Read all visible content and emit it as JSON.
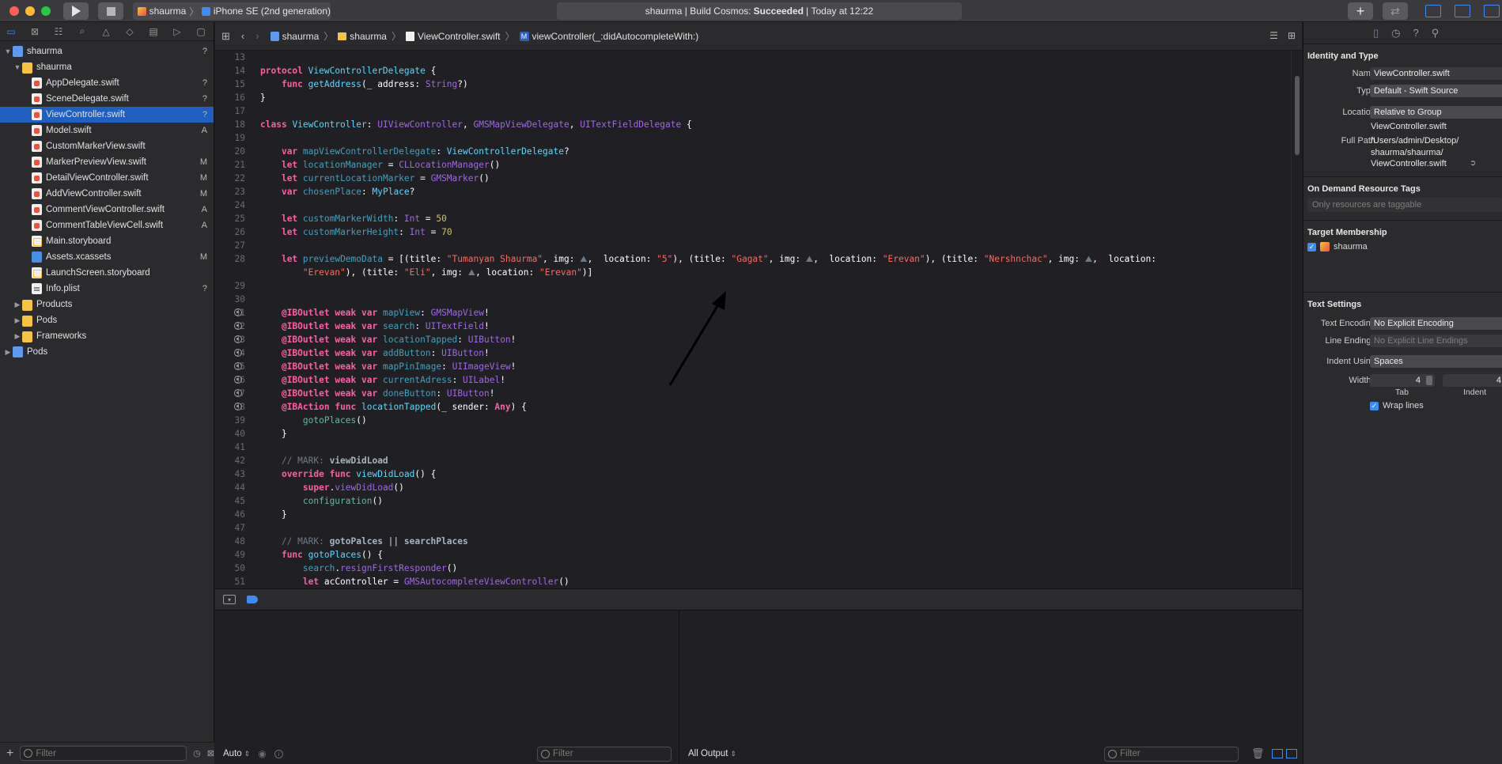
{
  "toolbar": {
    "scheme_target": "shaurma",
    "scheme_device": "iPhone SE (2nd generation)",
    "status_project": "shaurma",
    "status_build_label": "Build Cosmos:",
    "status_result": "Succeeded",
    "status_time": "Today at 12:22",
    "status_sep": "|"
  },
  "navigator": {
    "items": [
      {
        "label": "shaurma",
        "status": "?",
        "icon": "project-icon",
        "indent": 0,
        "disclosure": "open"
      },
      {
        "label": "shaurma",
        "status": "",
        "icon": "folder-icon",
        "indent": 1,
        "disclosure": "open"
      },
      {
        "label": "AppDelegate.swift",
        "status": "?",
        "icon": "swift-file-icon",
        "indent": 2
      },
      {
        "label": "SceneDelegate.swift",
        "status": "?",
        "icon": "swift-file-icon",
        "indent": 2
      },
      {
        "label": "ViewController.swift",
        "status": "?",
        "icon": "swift-file-icon",
        "indent": 2,
        "selected": true
      },
      {
        "label": "Model.swift",
        "status": "A",
        "icon": "swift-file-icon",
        "indent": 2
      },
      {
        "label": "CustomMarkerView.swift",
        "status": "",
        "icon": "swift-file-icon",
        "indent": 2
      },
      {
        "label": "MarkerPreviewView.swift",
        "status": "M",
        "icon": "swift-file-icon",
        "indent": 2
      },
      {
        "label": "DetailViewController.swift",
        "status": "M",
        "icon": "swift-file-icon",
        "indent": 2
      },
      {
        "label": "AddViewController.swift",
        "status": "M",
        "icon": "swift-file-icon",
        "indent": 2
      },
      {
        "label": "CommentViewController.swift",
        "status": "A",
        "icon": "swift-file-icon",
        "indent": 2
      },
      {
        "label": "CommentTableViewCell.swift",
        "status": "A",
        "icon": "swift-file-icon",
        "indent": 2
      },
      {
        "label": "Main.storyboard",
        "status": "",
        "icon": "storyboard-icon",
        "indent": 2
      },
      {
        "label": "Assets.xcassets",
        "status": "M",
        "icon": "assets-icon",
        "indent": 2
      },
      {
        "label": "LaunchScreen.storyboard",
        "status": "",
        "icon": "storyboard-icon",
        "indent": 2
      },
      {
        "label": "Info.plist",
        "status": "?",
        "icon": "plist-icon",
        "indent": 2
      },
      {
        "label": "Products",
        "status": "",
        "icon": "folder-icon",
        "indent": 1,
        "disclosure": "closed"
      },
      {
        "label": "Pods",
        "status": "",
        "icon": "folder-icon",
        "indent": 1,
        "disclosure": "closed"
      },
      {
        "label": "Frameworks",
        "status": "",
        "icon": "folder-icon",
        "indent": 1,
        "disclosure": "closed"
      },
      {
        "label": "Pods",
        "status": "",
        "icon": "project-icon",
        "indent": 0,
        "disclosure": "closed"
      }
    ],
    "filter_placeholder": "Filter"
  },
  "breadcrumb": {
    "project": "shaurma",
    "folder": "shaurma",
    "file": "ViewController.swift",
    "symbol_badge": "M",
    "symbol": "viewController(_:didAutocompleteWith:)"
  },
  "editor": {
    "lines": [
      {
        "n": "13",
        "html": ""
      },
      {
        "n": "14",
        "html": "<span class='kw'>protocol</span> <span class='ty'>ViewControllerDelegate</span> {"
      },
      {
        "n": "15",
        "html": "    <span class='kw'>func</span> <span class='ty'>getAddress</span>(_ address: <span class='tyb'>String</span>?)"
      },
      {
        "n": "16",
        "html": "}"
      },
      {
        "n": "17",
        "html": ""
      },
      {
        "n": "18",
        "html": "<span class='kw'>class</span> <span class='ty'>ViewController</span>: <span class='tyb'>UIViewController</span>, <span class='tyb'>GMSMapViewDelegate</span>, <span class='tyb'>UITextFieldDelegate</span> {"
      },
      {
        "n": "19",
        "html": ""
      },
      {
        "n": "20",
        "html": "    <span class='kw'>var</span> <span class='prop'>mapViewControllerDelegate</span>: <span class='ty'>ViewControllerDelegate</span>?"
      },
      {
        "n": "21",
        "html": "    <span class='kw'>let</span> <span class='prop'>locationManager</span> = <span class='tyb'>CLLocationManager</span>()"
      },
      {
        "n": "22",
        "html": "    <span class='kw'>let</span> <span class='prop'>currentLocationMarker</span> = <span class='tyb'>GMSMarker</span>()"
      },
      {
        "n": "23",
        "html": "    <span class='kw'>var</span> <span class='prop'>chosenPlace</span>: <span class='ty'>MyPlace</span>?"
      },
      {
        "n": "24",
        "html": ""
      },
      {
        "n": "25",
        "html": "    <span class='kw'>let</span> <span class='prop'>customMarkerWidth</span>: <span class='tyb'>Int</span> = <span class='num'>50</span>"
      },
      {
        "n": "26",
        "html": "    <span class='kw'>let</span> <span class='prop'>customMarkerHeight</span>: <span class='tyb'>Int</span> = <span class='num'>70</span>"
      },
      {
        "n": "27",
        "html": ""
      },
      {
        "n": "28",
        "html": "    <span class='kw'>let</span> <span class='prop'>previewDemoData</span> = [(title: <span class='str'>\"Tumanyan Shaurma\"</span>, img: <span class='cm'>⛰</span>,  location: <span class='str'>\"5\"</span>), (title: <span class='str'>\"Gagat\"</span>, img: <span class='cm'>⛰</span>,  location: <span class='str'>\"Erevan\"</span>), (title: <span class='str'>\"Nershnchac\"</span>, img: <span class='cm'>⛰</span>,  location:"
      },
      {
        "n": "",
        "html": "        <span class='str'>\"Erevan\"</span>), (title: <span class='str'>\"Eli\"</span>, img: <span class='cm'>⛰</span>, location: <span class='str'>\"Erevan\"</span>)]"
      },
      {
        "n": "29",
        "html": ""
      },
      {
        "n": "30",
        "html": ""
      },
      {
        "n": "31",
        "bp": true,
        "html": "    <span class='kw'>@IBOutlet</span> <span class='kw'>weak</span> <span class='kw'>var</span> <span class='prop'>mapView</span>: <span class='tyb'>GMSMapView</span>!"
      },
      {
        "n": "32",
        "bp": true,
        "html": "    <span class='kw'>@IBOutlet</span> <span class='kw'>weak</span> <span class='kw'>var</span> <span class='prop'>search</span>: <span class='tyb'>UITextField</span>!"
      },
      {
        "n": "33",
        "bp": true,
        "html": "    <span class='kw'>@IBOutlet</span> <span class='kw'>weak</span> <span class='kw'>var</span> <span class='prop'>locationTapped</span>: <span class='tyb'>UIButton</span>!"
      },
      {
        "n": "34",
        "bp": true,
        "html": "    <span class='kw'>@IBOutlet</span> <span class='kw'>weak</span> <span class='kw'>var</span> <span class='prop'>addButton</span>: <span class='tyb'>UIButton</span>!"
      },
      {
        "n": "35",
        "bp": true,
        "html": "    <span class='kw'>@IBOutlet</span> <span class='kw'>weak</span> <span class='kw'>var</span> <span class='prop'>mapPinImage</span>: <span class='tyb'>UIImageView</span>!"
      },
      {
        "n": "36",
        "bp": true,
        "html": "    <span class='kw'>@IBOutlet</span> <span class='kw'>weak</span> <span class='kw'>var</span> <span class='prop'>currentAdress</span>: <span class='tyb'>UILabel</span>!"
      },
      {
        "n": "37",
        "bp": true,
        "html": "    <span class='kw'>@IBOutlet</span> <span class='kw'>weak</span> <span class='kw'>var</span> <span class='prop'>doneButton</span>: <span class='tyb'>UIButton</span>!"
      },
      {
        "n": "38",
        "bp": true,
        "html": "    <span class='kw'>@IBAction</span> <span class='kw'>func</span> <span class='ty'>locationTapped</span>(_ sender: <span class='kw'>Any</span>) {"
      },
      {
        "n": "39",
        "html": "        <span class='fn'>gotoPlaces</span>()"
      },
      {
        "n": "40",
        "html": "    }"
      },
      {
        "n": "41",
        "html": ""
      },
      {
        "n": "42",
        "html": "    <span class='cm'>// MARK: </span><span class='cmb'>viewDidLoad</span>"
      },
      {
        "n": "43",
        "html": "    <span class='kw'>override</span> <span class='kw'>func</span> <span class='ty'>viewDidLoad</span>() {"
      },
      {
        "n": "44",
        "html": "        <span class='kw'>super</span>.<span class='tyb'>viewDidLoad</span>()"
      },
      {
        "n": "45",
        "html": "        <span class='fn'>configuration</span>()"
      },
      {
        "n": "46",
        "html": "    }"
      },
      {
        "n": "47",
        "html": ""
      },
      {
        "n": "48",
        "html": "    <span class='cm'>// MARK: </span><span class='cmb'>gotoPalces || searchPlaces</span>"
      },
      {
        "n": "49",
        "html": "    <span class='kw'>func</span> <span class='ty'>gotoPlaces</span>() {"
      },
      {
        "n": "50",
        "html": "        <span class='prop'>search</span>.<span class='tyb'>resignFirstResponder</span>()"
      },
      {
        "n": "51",
        "html": "        <span class='kw'>let</span> acController = <span class='tyb'>GMSAutocompleteViewController</span>()"
      }
    ]
  },
  "debug": {
    "var_view_selector": "Auto",
    "output_selector": "All Output",
    "filter_placeholder": "Filter"
  },
  "inspector": {
    "identity_title": "Identity and Type",
    "name_label": "Name",
    "name_value": "ViewController.swift",
    "type_label": "Type",
    "type_value": "Default - Swift Source",
    "location_label": "Location",
    "location_value": "Relative to Group",
    "location_file": "ViewController.swift",
    "full_path_label": "Full Path",
    "full_path_1": "/Users/admin/Desktop/",
    "full_path_2": "shaurma/shaurma/",
    "full_path_3": "ViewController.swift",
    "odr_title": "On Demand Resource Tags",
    "odr_placeholder": "Only resources are taggable",
    "target_title": "Target Membership",
    "target_name": "shaurma",
    "text_title": "Text Settings",
    "encoding_label": "Text Encoding",
    "encoding_value": "No Explicit Encoding",
    "line_endings_label": "Line Endings",
    "line_endings_value": "No Explicit Line Endings",
    "indent_using_label": "Indent Using",
    "indent_using_value": "Spaces",
    "widths_label": "Widths",
    "tab_width": "4",
    "indent_width": "4",
    "tab_label": "Tab",
    "indent_label": "Indent",
    "wrap_lines_label": "Wrap lines"
  }
}
